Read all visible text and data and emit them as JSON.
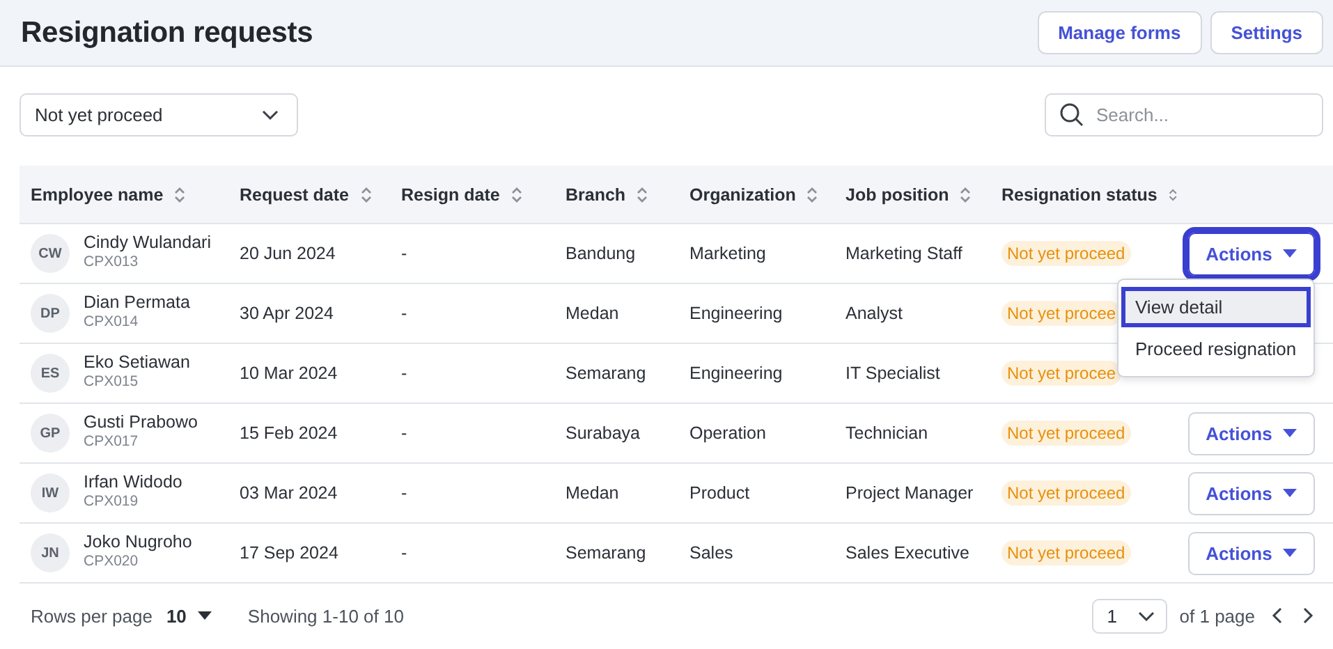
{
  "header": {
    "title": "Resignation requests",
    "buttons": [
      "Manage forms",
      "Settings"
    ]
  },
  "filter": {
    "value": "Not yet proceed"
  },
  "search": {
    "placeholder": "Search..."
  },
  "table": {
    "columns": [
      "Employee name",
      "Request date",
      "Resign date",
      "Branch",
      "Organization",
      "Job position",
      "Resignation status"
    ],
    "rows": [
      {
        "initials": "CW",
        "name": "Cindy Wulandari",
        "id": "CPX013",
        "request_date": "20 Jun 2024",
        "resign_date": "-",
        "branch": "Bandung",
        "organization": "Marketing",
        "job_position": "Marketing Staff",
        "status": "Not yet proceed",
        "action": {
          "label": "Actions",
          "highlighted": true
        }
      },
      {
        "initials": "DP",
        "name": "Dian Permata",
        "id": "CPX014",
        "request_date": "30 Apr 2024",
        "resign_date": "-",
        "branch": "Medan",
        "organization": "Engineering",
        "job_position": "Analyst",
        "status": "Not yet procee"
      },
      {
        "initials": "ES",
        "name": "Eko Setiawan",
        "id": "CPX015",
        "request_date": "10 Mar 2024",
        "resign_date": "-",
        "branch": "Semarang",
        "organization": "Engineering",
        "job_position": "IT Specialist",
        "status": "Not yet procee"
      },
      {
        "initials": "GP",
        "name": "Gusti Prabowo",
        "id": "CPX017",
        "request_date": "15 Feb 2024",
        "resign_date": "-",
        "branch": "Surabaya",
        "organization": "Operation",
        "job_position": "Technician",
        "status": "Not yet proceed",
        "action": {
          "label": "Actions",
          "highlighted": false
        }
      },
      {
        "initials": "IW",
        "name": "Irfan Widodo",
        "id": "CPX019",
        "request_date": "03 Mar 2024",
        "resign_date": "-",
        "branch": "Medan",
        "organization": "Product",
        "job_position": "Project Manager",
        "status": "Not yet proceed",
        "action": {
          "label": "Actions",
          "highlighted": false
        }
      },
      {
        "initials": "JN",
        "name": "Joko Nugroho",
        "id": "CPX020",
        "request_date": "17 Sep 2024",
        "resign_date": "-",
        "branch": "Semarang",
        "organization": "Sales",
        "job_position": "Sales Executive",
        "status": "Not yet proceed",
        "action": {
          "label": "Actions",
          "highlighted": false
        }
      }
    ]
  },
  "menu": {
    "items": [
      {
        "label": "View detail",
        "highlighted": true
      },
      {
        "label": "Proceed resignation",
        "highlighted": false
      }
    ]
  },
  "footer": {
    "rows_per_page_label": "Rows per page",
    "rows_per_page": "10",
    "showing": "Showing 1-10 of 10",
    "page": "1",
    "page_total": "of 1 page"
  }
}
